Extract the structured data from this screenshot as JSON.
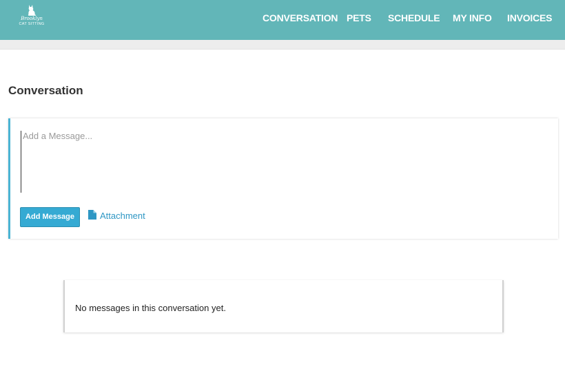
{
  "brand": {
    "name_line1": "Brooklyn",
    "name_line2": "CAT SITTING",
    "logo_icon": "cat-icon"
  },
  "nav": {
    "items": [
      {
        "label": "CONVERSATION"
      },
      {
        "label": "PETS"
      },
      {
        "label": "SCHEDULE"
      },
      {
        "label": "MY INFO"
      },
      {
        "label": "INVOICES"
      }
    ]
  },
  "page": {
    "title": "Conversation"
  },
  "compose": {
    "message_value": "",
    "message_placeholder": "Add a Message...",
    "add_button_label": "Add Message",
    "attachment_label": "Attachment",
    "attachment_icon": "file-icon"
  },
  "messages": {
    "empty_text": "No messages in this conversation yet."
  },
  "colors": {
    "header": "#62b6b8",
    "accent": "#35aad3",
    "link": "#2e97c4"
  }
}
